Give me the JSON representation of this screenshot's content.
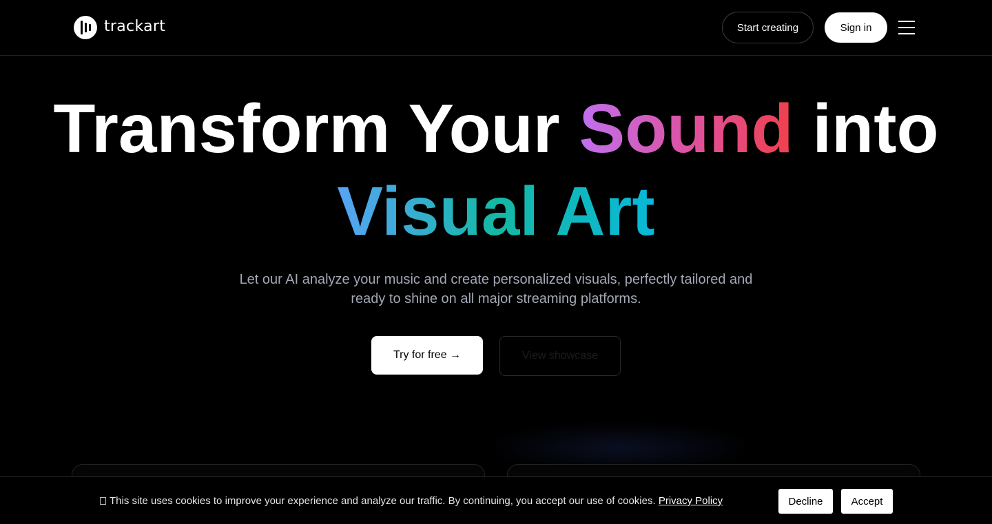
{
  "header": {
    "brand": "trackart",
    "start_creating": "Start creating",
    "sign_in": "Sign in"
  },
  "hero": {
    "line1_a": "Transform Your ",
    "line1_highlight": "Sound",
    "line1_b": " into",
    "line2": "Visual Art",
    "subtitle_1": "Let our AI analyze your music and create personalized visuals, perfectly tailored and",
    "subtitle_2": "ready to shine on all major streaming platforms.",
    "try_free": "Try for free →",
    "view_showcase": "View showcase"
  },
  "cookie": {
    "text": "This site uses cookies to improve your experience and analyze our traffic. By continuing, you accept our use of cookies. ",
    "link": "Privacy Policy",
    "decline": "Decline",
    "accept": "Accept"
  },
  "icons": {
    "logo": "soundbars-logo-icon",
    "menu": "hamburger-menu-icon",
    "cookie": "cookie-icon"
  },
  "colors": {
    "background": "#000000",
    "subtitle": "#a3a8b4",
    "sound_gradient": [
      "#c070f0",
      "#e0509a",
      "#f0404a"
    ],
    "visual_art_gradient": [
      "#58a4f6",
      "#14b8a6",
      "#0ab8d8"
    ]
  }
}
